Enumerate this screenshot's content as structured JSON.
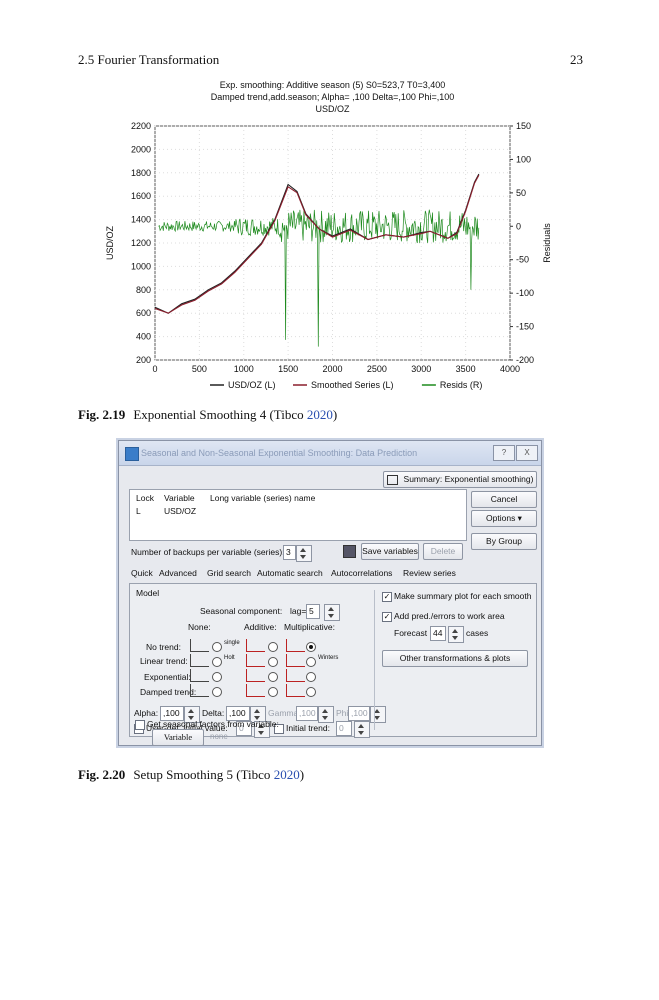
{
  "header": {
    "section": "2.5   Fourier Transformation",
    "page": "23"
  },
  "chart_data": {
    "type": "line",
    "title": [
      "Exp. smoothing: Additive season (5) S0=523,7 T0=3,400",
      "Damped trend,add.season; Alpha=  ,100 Delta=,100 Phi=,100",
      "USD/OZ"
    ],
    "xlabel": "",
    "ylabel_left": "USD/OZ",
    "ylabel_right": "Residuals",
    "xlim": [
      0,
      4000
    ],
    "ylim_left": [
      200,
      2200
    ],
    "ylim_right": [
      -200,
      150
    ],
    "x_ticks": [
      "0",
      "500",
      "1000",
      "1500",
      "2000",
      "2500",
      "3000",
      "3500",
      "4000"
    ],
    "y_ticks_left": [
      "200",
      "400",
      "600",
      "800",
      "1000",
      "1200",
      "1400",
      "1600",
      "1800",
      "2000",
      "2200"
    ],
    "y_ticks_right": [
      "-200",
      "-150",
      "-100",
      "-50",
      "0",
      "50",
      "100",
      "150"
    ],
    "grid": true,
    "legend_position": "bottom",
    "series": [
      {
        "name": "USD/OZ (L)",
        "color": "#222222",
        "x": [
          0,
          150,
          300,
          450,
          600,
          750,
          900,
          1050,
          1200,
          1350,
          1500,
          1600,
          1700,
          1850,
          2000,
          2200,
          2400,
          2600,
          2800,
          3000,
          3100,
          3200,
          3300,
          3400,
          3500,
          3600,
          3650
        ],
        "y": [
          650,
          600,
          680,
          720,
          800,
          860,
          960,
          1080,
          1200,
          1400,
          1700,
          1640,
          1450,
          1320,
          1260,
          1320,
          1230,
          1270,
          1250,
          1290,
          1300,
          1270,
          1240,
          1290,
          1480,
          1720,
          1790
        ]
      },
      {
        "name": "Smoothed Series (L)",
        "color": "#8b1d2c",
        "x": [
          0,
          150,
          300,
          450,
          600,
          750,
          900,
          1050,
          1200,
          1350,
          1500,
          1600,
          1700,
          1850,
          2000,
          2200,
          2400,
          2600,
          2800,
          3000,
          3100,
          3200,
          3300,
          3400,
          3500,
          3600,
          3650
        ],
        "y": [
          640,
          600,
          670,
          710,
          790,
          850,
          950,
          1070,
          1190,
          1390,
          1680,
          1630,
          1440,
          1320,
          1250,
          1310,
          1230,
          1270,
          1250,
          1280,
          1300,
          1270,
          1240,
          1280,
          1470,
          1710,
          1780
        ]
      },
      {
        "name": "Resids (R)",
        "color": "#1e8a1e",
        "mean": 0,
        "spread": 25
      }
    ]
  },
  "fig_219": {
    "label": "Fig. 2.19",
    "text": "Exponential Smoothing 4 (Tibco ",
    "year": "2020",
    "close": ")"
  },
  "dialog": {
    "title": "Seasonal and Non-Seasonal Exponential Smoothing: Data Prediction",
    "title_help": "?",
    "title_close": "X",
    "summary_button": "Summary:  Exponential smoothing)",
    "cancel_button": "Cancel",
    "options_button": "Options ▾",
    "bygroup_button": "By Group",
    "columns": [
      "Lock",
      "Variable",
      "Long variable (series) name"
    ],
    "row": {
      "lock": "L",
      "variable": "USD/OZ"
    },
    "backups_label": "Number of backups per variable (series):",
    "backups_value": "3",
    "save_button": "Save variables",
    "delete_button": "Delete",
    "tabs": [
      "Quick",
      "Advanced",
      "Grid search",
      "Automatic search",
      "Autocorrelations",
      "Review series"
    ],
    "model_label": "Model",
    "seasonal_component": "Seasonal component:",
    "lag_label": "lag=",
    "lag_value": "5",
    "col_none": "None:",
    "col_additive": "Additive:",
    "col_mult": "Multiplicative:",
    "rows": [
      "No trend:",
      "Linear trend:",
      "Exponential:",
      "Damped trend:"
    ],
    "single_label": "single",
    "holt_label": "Holt",
    "winters_label": "Winters",
    "alpha_label": "Alpha:",
    "alpha_value": ",100",
    "delta_label": "Delta:",
    "delta_value": ",100",
    "gamma_label": "Gamma",
    "gamma_value": ",100",
    "phi_label": "Phi",
    "phi_value": ",100",
    "userdef_label": "User-def. initial value:",
    "userdef_value": "0",
    "initial_trend_label": "Initial trend:",
    "initial_trend_value": "0",
    "get_seasonal_label": "Get seasonal factors from variable:",
    "variable_button": "Variable",
    "none_text": "none",
    "make_summary_label": "Make summary plot for each smooth",
    "add_pred_label": "Add pred./errors to work area",
    "forecast_label": "Forecast",
    "forecast_value": "44",
    "cases_label": "cases",
    "other_button": "Other transformations & plots"
  },
  "fig_220": {
    "label": "Fig. 2.20",
    "text": "Setup Smoothing 5 (Tibco ",
    "year": "2020",
    "close": ")"
  }
}
